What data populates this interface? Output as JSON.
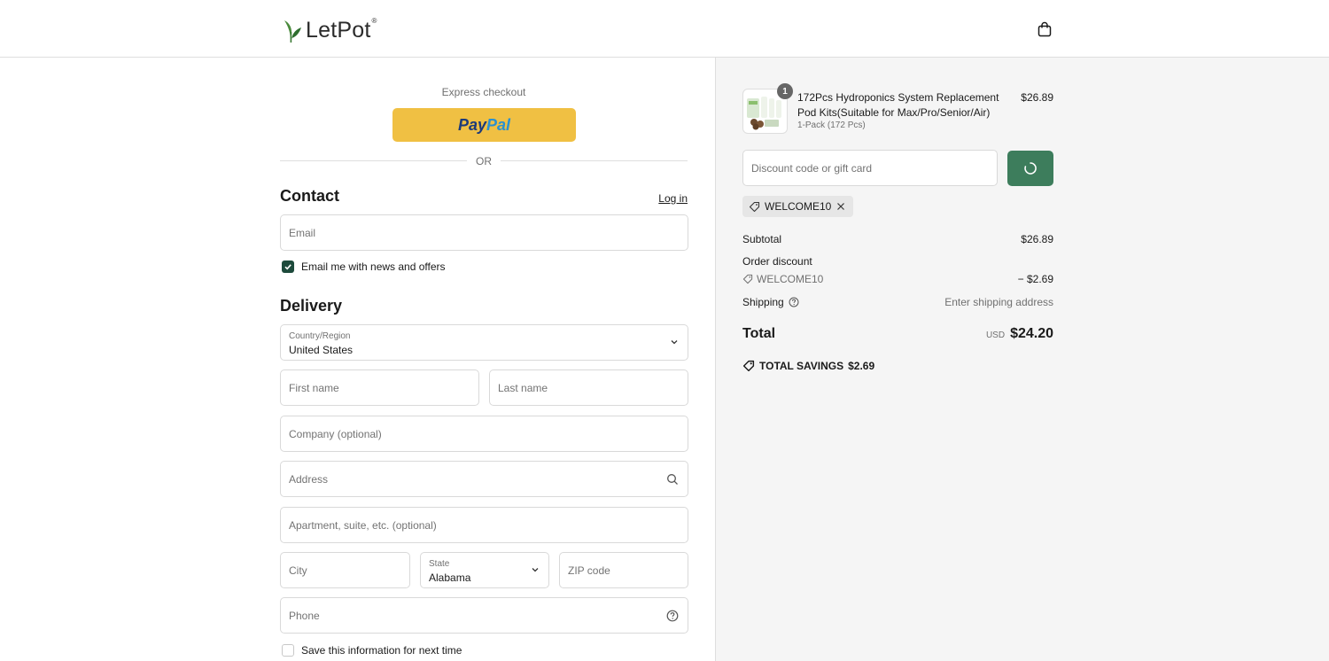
{
  "header": {
    "brand": "LetPot",
    "brand_mark": "®",
    "cart_icon": "shopping-bag-icon"
  },
  "express": {
    "label": "Express checkout",
    "paypal_part1": "Pay",
    "paypal_part2": "Pal",
    "divider": "OR"
  },
  "contact": {
    "title": "Contact",
    "login": "Log in",
    "email_placeholder": "Email",
    "news_label": "Email me with news and offers",
    "news_checked": true
  },
  "delivery": {
    "title": "Delivery",
    "country_label": "Country/Region",
    "country_value": "United States",
    "first_name_placeholder": "First name",
    "last_name_placeholder": "Last name",
    "company_placeholder": "Company (optional)",
    "address_placeholder": "Address",
    "apartment_placeholder": "Apartment, suite, etc. (optional)",
    "city_placeholder": "City",
    "state_label": "State",
    "state_value": "Alabama",
    "zip_placeholder": "ZIP code",
    "phone_placeholder": "Phone",
    "save_info_label": "Save this information for next time",
    "save_info_checked": false
  },
  "order": {
    "product": {
      "quantity": "1",
      "title": "172Pcs Hydroponics System Replacement Pod Kits(Suitable for Max/Pro/Senior/Air)",
      "variant": "1-Pack (172 Pcs)",
      "price": "$26.89"
    },
    "discount_placeholder": "Discount code or gift card",
    "applied_code": "WELCOME10",
    "subtotal_label": "Subtotal",
    "subtotal_value": "$26.89",
    "order_discount_label": "Order discount",
    "discount_code": "WELCOME10",
    "discount_value": "− $2.69",
    "shipping_label": "Shipping",
    "shipping_value": "Enter shipping address",
    "total_label": "Total",
    "currency": "USD",
    "total_value": "$24.20",
    "savings_label": "TOTAL SAVINGS",
    "savings_value": "$2.69"
  },
  "colors": {
    "accent": "#3d7d5c",
    "checkbox": "#1d4a3b",
    "paypal": "#f0c043"
  }
}
